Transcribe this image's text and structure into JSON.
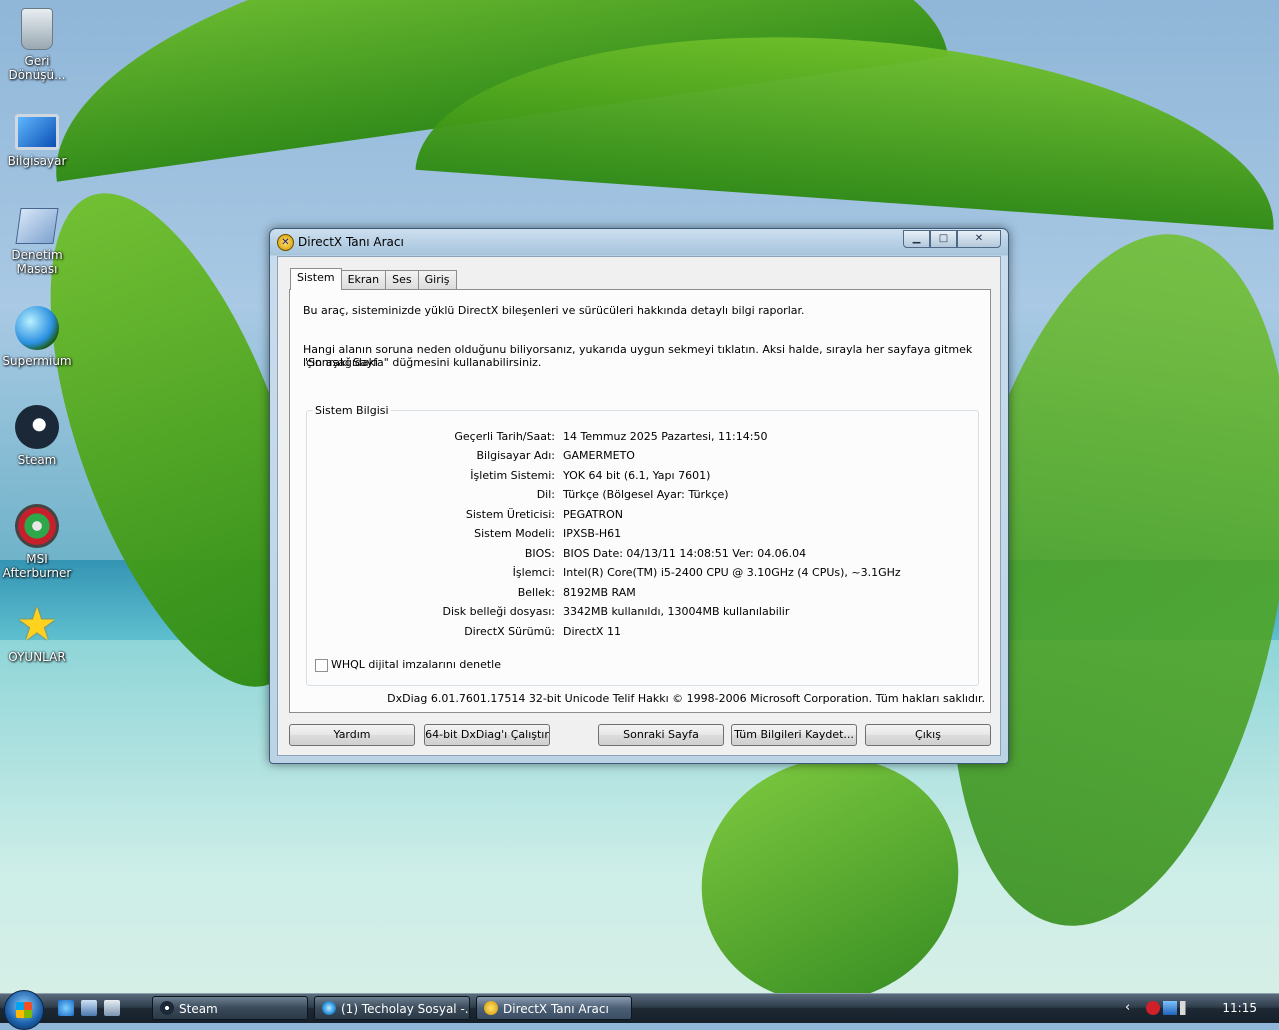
{
  "desktop": {
    "icons": [
      {
        "label": "Geri Dönüşü...",
        "icon": "recycle-bin-icon"
      },
      {
        "label": "Bilgisayar",
        "icon": "computer-icon"
      },
      {
        "label": "Denetim Masası",
        "icon": "control-panel-icon"
      },
      {
        "label": "Supermium",
        "icon": "supermium-icon"
      },
      {
        "label": "Steam",
        "icon": "steam-icon"
      },
      {
        "label": "MSI Afterburner",
        "icon": "msi-afterburner-icon"
      },
      {
        "label": "OYUNLAR",
        "icon": "star-icon"
      }
    ]
  },
  "window": {
    "title": "DirectX Tanı Aracı",
    "caption_buttons": {
      "minimize": "▁",
      "maximize": "□",
      "close": "✕"
    },
    "tabs": [
      {
        "label": "Sistem",
        "active": true
      },
      {
        "label": "Ekran",
        "active": false
      },
      {
        "label": "Ses",
        "active": false
      },
      {
        "label": "Giriş",
        "active": false
      }
    ],
    "intro": "Bu araç, sisteminizde yüklü DirectX bileşenleri ve sürücüleri hakkında detaylı bilgi raporlar.",
    "instructions_line1": "Hangi alanın soruna neden olduğunu biliyorsanız, yukarıda uygun sekmeyi tıklatın.  Aksi halde, sırayla her sayfaya gitmek için aşağıdaki",
    "instructions_line2": "\"Sonraki Sayfa\" düğmesini kullanabilirsiniz.",
    "group_title": "Sistem Bilgisi",
    "info": [
      {
        "label": "Geçerli Tarih/Saat:",
        "value": "14 Temmuz 2025 Pazartesi, 11:14:50"
      },
      {
        "label": "Bilgisayar Adı:",
        "value": "GAMERMETO"
      },
      {
        "label": "İşletim Sistemi:",
        "value": "YOK 64 bit (6.1, Yapı 7601)"
      },
      {
        "label": "Dil:",
        "value": "Türkçe (Bölgesel Ayar: Türkçe)"
      },
      {
        "label": "Sistem Üreticisi:",
        "value": "PEGATRON"
      },
      {
        "label": "Sistem Modeli:",
        "value": "IPXSB-H61"
      },
      {
        "label": "BIOS:",
        "value": "BIOS Date: 04/13/11 14:08:51 Ver: 04.06.04"
      },
      {
        "label": "İşlemci:",
        "value": "Intel(R) Core(TM) i5-2400 CPU @ 3.10GHz (4 CPUs), ~3.1GHz"
      },
      {
        "label": "Bellek:",
        "value": "8192MB RAM"
      },
      {
        "label": "Disk belleği dosyası:",
        "value": "3342MB kullanıldı, 13004MB kullanılabilir"
      },
      {
        "label": "DirectX Sürümü:",
        "value": "DirectX 11"
      }
    ],
    "whql_checkbox": {
      "label": "WHQL dijital imzalarını denetle",
      "checked": false
    },
    "footer": "DxDiag 6.01.7601.17514 32-bit Unicode  Telif Hakkı © 1998-2006 Microsoft Corporation.  Tüm hakları saklıdır.",
    "buttons": {
      "help": "Yardım",
      "run64": "64-bit DxDiag'ı Çalıştır",
      "next": "Sonraki Sayfa",
      "saveall": "Tüm Bilgileri Kaydet...",
      "exit": "Çıkış"
    }
  },
  "taskbar": {
    "tasks": [
      {
        "label": "Steam",
        "icon": "steam-icon"
      },
      {
        "label": "(1) Techolay Sosyal -...",
        "icon": "supermium-icon"
      },
      {
        "label": "DirectX Tanı Aracı",
        "icon": "directx-icon"
      }
    ],
    "clock": "11:15",
    "tray_chevron": "‹"
  },
  "colors": {
    "window_frame": "#a6c4dc",
    "taskbar": "#1d2834",
    "palm_green": "#4fa81c"
  }
}
